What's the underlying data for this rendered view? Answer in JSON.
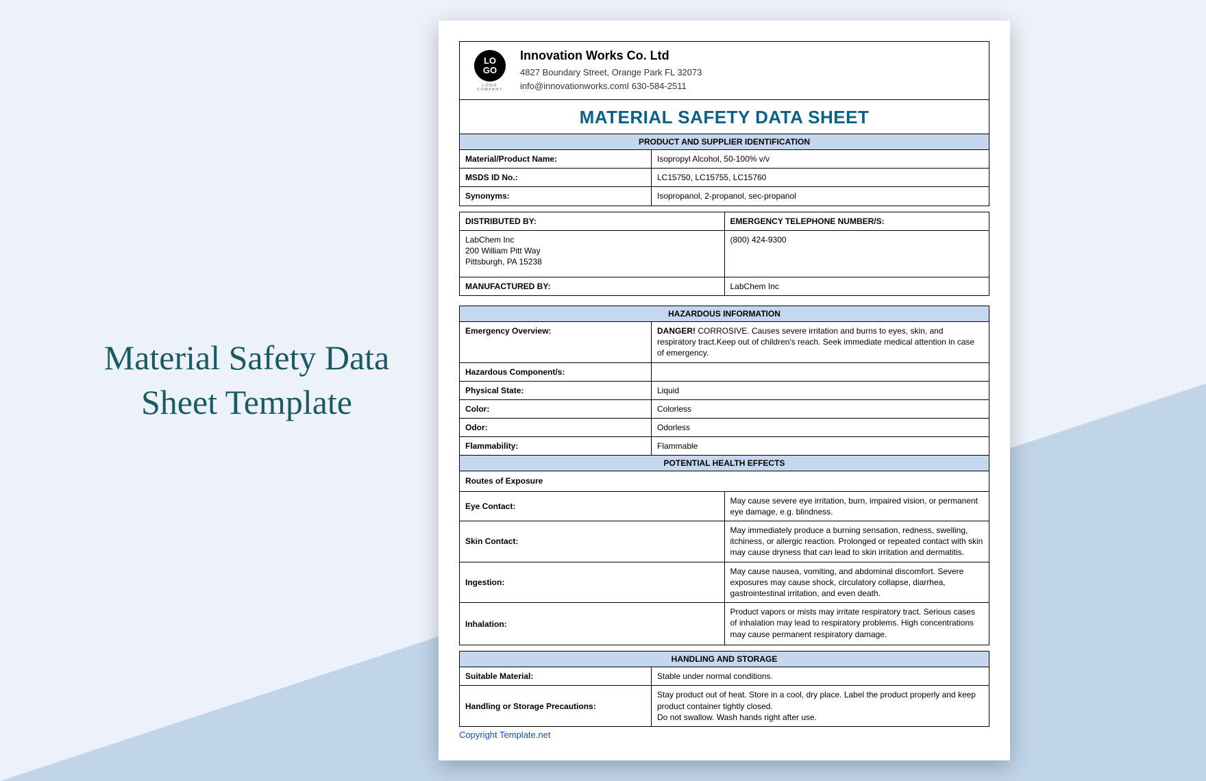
{
  "page": {
    "heading_line1": "Material Safety Data",
    "heading_line2": "Sheet Template"
  },
  "logo": {
    "top": "LO",
    "bottom": "GO",
    "sub": "LOGO COMPANY"
  },
  "company": {
    "name": "Innovation Works Co. Ltd",
    "address": "4827 Boundary Street, Orange Park FL 32073",
    "contact": "info@innovationworks.comI 630-584-2511"
  },
  "doc_title": "MATERIAL SAFETY DATA SHEET",
  "sec1": {
    "header": "PRODUCT AND SUPPLIER IDENTIFICATION",
    "material_label": "Material/Product Name:",
    "material_value": "Isopropyl Alcohol, 50-100% v/v",
    "msds_label": "MSDS ID No.:",
    "msds_value": "LC15750, LC15755, LC15760",
    "syn_label": "Synonyms:",
    "syn_value": "Isopropanol, 2-propanol, sec-propanol",
    "dist_label": "DISTRIBUTED BY:",
    "emerg_label": "EMERGENCY TELEPHONE NUMBER/S:",
    "dist_value": "LabChem Inc\n200 William Pitt Way\nPittsburgh, PA 15238",
    "emerg_value": "(800) 424-9300",
    "manu_label": "MANUFACTURED BY:",
    "manu_value": "LabChem Inc"
  },
  "sec2": {
    "header": "HAZARDOUS INFORMATION",
    "overview_label": "Emergency Overview:",
    "overview_value_prefix": "DANGER!",
    "overview_value_rest": " CORROSIVE. Causes severe irritation and burns to eyes, skin, and respiratory tract.Keep out of children's reach. Seek immediate medical attention in case of emergency.",
    "components_label": "Hazardous Component/s:",
    "components_value": "",
    "state_label": "Physical State:",
    "state_value": "Liquid",
    "color_label": "Color:",
    "color_value": "Colorless",
    "odor_label": "Odor:",
    "odor_value": "Odorless",
    "flam_label": "Flammability:",
    "flam_value": "Flammable"
  },
  "sec3": {
    "header": "POTENTIAL HEALTH EFFECTS",
    "routes_label": "Routes of Exposure",
    "eye_label": "Eye Contact:",
    "eye_value": "May cause severe eye irritation, burn, impaired vision, or permanent eye damage, e.g. blindness.",
    "skin_label": "Skin Contact:",
    "skin_value": "May immediately produce a burning sensation, redness, swelling, itchiness, or allergic reaction. Prolonged or repeated contact with skin may cause dryness that can lead to skin irritation and dermatitis.",
    "ing_label": "Ingestion:",
    "ing_value": "May cause nausea, vomiting, and abdominal discomfort. Severe exposures may cause shock, circulatory collapse, diarrhea, gastrointestinal irritation, and even death.",
    "inh_label": "Inhalation:",
    "inh_value": "Product vapors or mists may irritate respiratory tract. Serious cases of inhalation may lead to respiratory problems. High concentrations may cause permanent respiratory damage."
  },
  "sec4": {
    "header": "HANDLING AND STORAGE",
    "suitable_label": "Suitable Material:",
    "suitable_value": "Stable under normal conditions.",
    "handling_label": "Handling or Storage Precautions:",
    "handling_value": "Stay product out of heat. Store in a cool, dry place. Label the product properly and keep product container tightly closed.\nDo not swallow. Wash hands right after use."
  },
  "copyright": "Copyright Template.net"
}
